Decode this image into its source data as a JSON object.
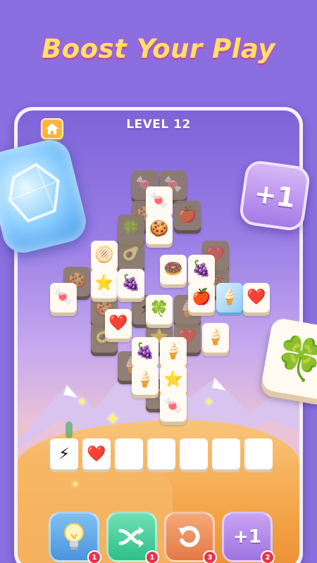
{
  "headline": "Boost Your Play",
  "game": {
    "level_label": "LEVEL 12",
    "home_icon": "home-icon"
  },
  "board_tiles": [
    {
      "icon": "candy",
      "glyph": "🍬",
      "state": "active"
    },
    {
      "icon": "cookie",
      "glyph": "🍪",
      "state": "active"
    },
    {
      "icon": "macaron",
      "glyph": "🟦",
      "state": "active"
    },
    {
      "icon": "donut",
      "glyph": "🍩",
      "state": "active"
    },
    {
      "icon": "grapes",
      "glyph": "🍇",
      "state": "active"
    },
    {
      "icon": "star",
      "glyph": "⭐",
      "state": "active"
    },
    {
      "icon": "candy",
      "glyph": "🍬",
      "state": "active"
    },
    {
      "icon": "heart",
      "glyph": "❤️",
      "state": "active"
    },
    {
      "icon": "clover",
      "glyph": "🍀",
      "state": "active"
    },
    {
      "icon": "apple",
      "glyph": "🍎",
      "state": "active"
    },
    {
      "icon": "ice-cream",
      "glyph": "🍦",
      "state": "frozen"
    },
    {
      "icon": "heart",
      "glyph": "❤️",
      "state": "active"
    },
    {
      "icon": "ice-cream",
      "glyph": "🍦",
      "state": "active"
    },
    {
      "icon": "grapes",
      "glyph": "🍇",
      "state": "active"
    },
    {
      "icon": "ice-cream",
      "glyph": "🍦",
      "state": "active"
    },
    {
      "icon": "star",
      "glyph": "⭐",
      "state": "active"
    }
  ],
  "tray": {
    "capacity": 7,
    "filled": [
      {
        "icon": "lightning",
        "glyph": "⚡"
      },
      {
        "icon": "heart",
        "glyph": "❤️"
      }
    ]
  },
  "boosters": [
    {
      "name": "hint",
      "icon": "lightbulb-icon",
      "count": "1",
      "color": "#5aa8e8"
    },
    {
      "name": "shuffle",
      "icon": "shuffle-icon",
      "count": "1",
      "color": "#3fcf9a"
    },
    {
      "name": "undo",
      "icon": "undo-icon",
      "count": "3",
      "color": "#f0915c"
    },
    {
      "name": "extra-slot",
      "icon": "plus-one-icon",
      "label": "+1",
      "count": "2",
      "color": "#b68ae8"
    }
  ],
  "floating_items": {
    "plus_one_badge": "+1",
    "ice_block": "ice-block-icon",
    "clover_tile": "clover-icon"
  },
  "colors": {
    "background": "#8a6fe0",
    "headline": "#ffe066",
    "accent_pink": "#b64ab0"
  }
}
